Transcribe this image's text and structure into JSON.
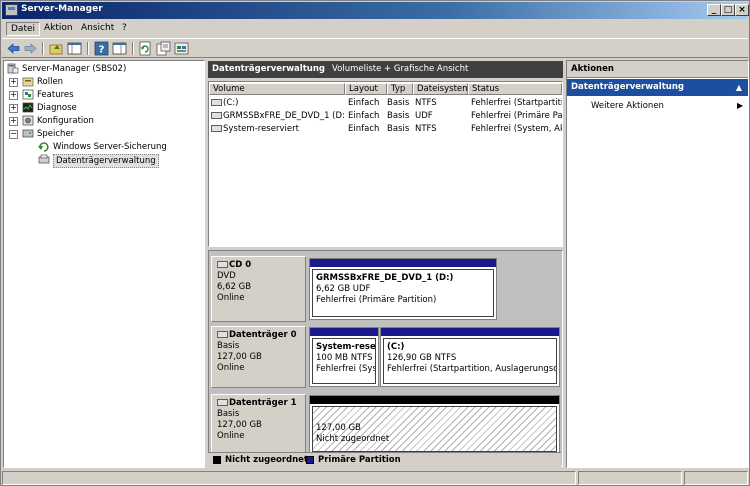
{
  "window": {
    "title": "Server-Manager"
  },
  "menu": {
    "items": [
      "Datei",
      "Aktion",
      "Ansicht",
      "?"
    ]
  },
  "tree": {
    "root": "Server-Manager (SBS02)",
    "nodes": [
      "Rollen",
      "Features",
      "Diagnose",
      "Konfiguration",
      "Speicher"
    ],
    "storage_children": [
      "Windows Server-Sicherung",
      "Datenträgerverwaltung"
    ]
  },
  "center": {
    "header_title": "Datenträgerverwaltung",
    "header_subtitle": "Volumeliste + Grafische Ansicht",
    "columns": [
      "Volume",
      "Layout",
      "Typ",
      "Dateisystem",
      "Status"
    ],
    "rows": [
      [
        "(C:)",
        "Einfach",
        "Basis",
        "NTFS",
        "Fehlerfrei (Startpartition"
      ],
      [
        "GRMSSBxFRE_DE_DVD_1 (D:)",
        "Einfach",
        "Basis",
        "UDF",
        "Fehlerfrei (Primäre Parti"
      ],
      [
        "System-reserviert",
        "Einfach",
        "Basis",
        "NTFS",
        "Fehlerfrei (System, Akti"
      ]
    ]
  },
  "disks": [
    {
      "name": "CD 0",
      "type": "DVD",
      "size": "6,62 GB",
      "state": "Online",
      "partitions": [
        {
          "name": "GRMSSBxFRE_DE_DVD_1  (D:)",
          "line2": "6,62 GB UDF",
          "line3": "Fehlerfrei (Primäre Partition)"
        }
      ]
    },
    {
      "name": "Datenträger 0",
      "type": "Basis",
      "size": "127,00 GB",
      "state": "Online",
      "partitions": [
        {
          "name": "System-rese",
          "line2": "100 MB NTFS",
          "line3": "Fehlerfrei (Syst"
        },
        {
          "name": "(C:)",
          "line2": "126,90 GB NTFS",
          "line3": "Fehlerfrei (Startpartition, Auslagerungsdate"
        }
      ]
    },
    {
      "name": "Datenträger 1",
      "type": "Basis",
      "size": "127,00 GB",
      "state": "Online",
      "partitions": [
        {
          "line2": "127,00 GB",
          "line3": "Nicht zugeordnet"
        }
      ]
    }
  ],
  "legend": {
    "unallocated": "Nicht zugeordnet",
    "primary": "Primäre Partition",
    "unallocated_color": "#000000",
    "primary_color": "#1a1a8c"
  },
  "actions": {
    "header": "Aktionen",
    "section": "Datenträgerverwaltung",
    "item": "Weitere Aktionen"
  }
}
